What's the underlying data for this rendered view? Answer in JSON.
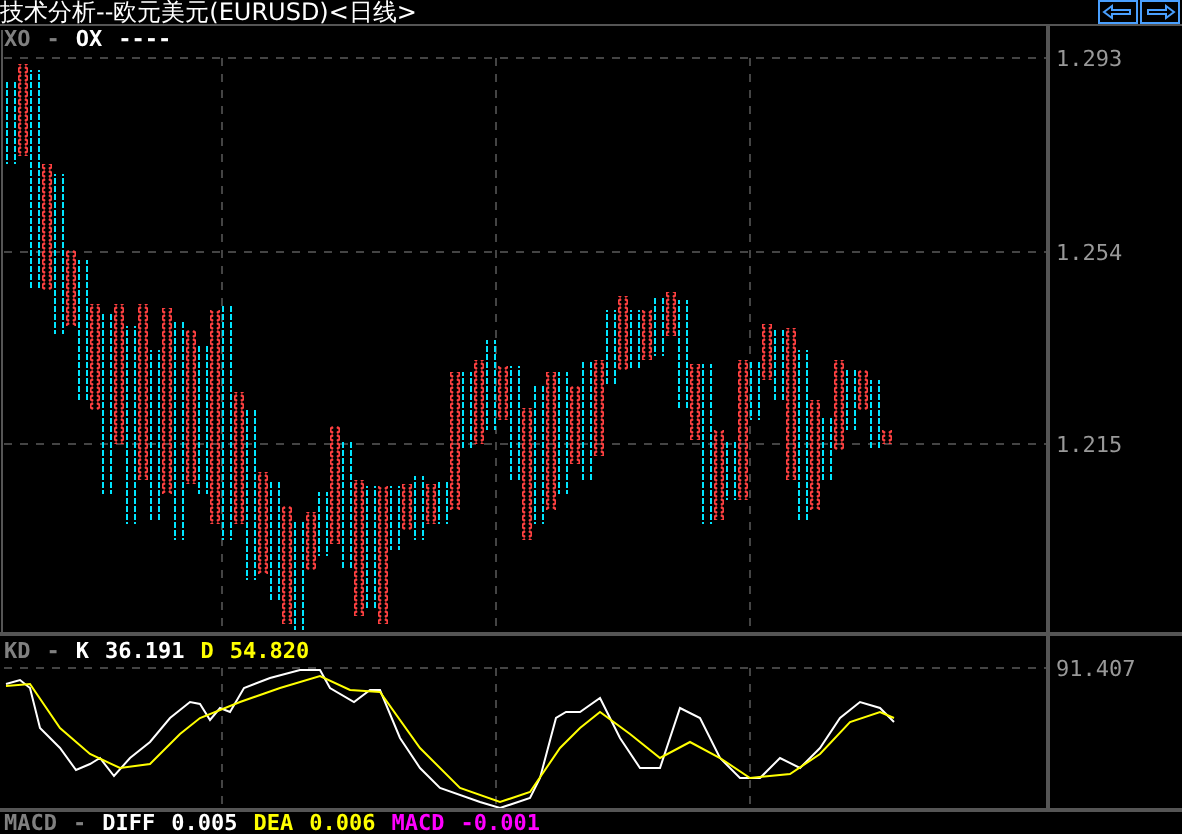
{
  "window": {
    "title": "技术分析--欧元美元(EURUSD)<日线>"
  },
  "main_chart": {
    "legend": [
      {
        "text": "XO",
        "color": "#808080"
      },
      {
        "text": "-",
        "color": "#808080"
      },
      {
        "text": "OX",
        "color": "#ffffff"
      },
      {
        "text": "----",
        "color": "#ffffff"
      }
    ],
    "axis_labels": [
      "1.293",
      "1.254",
      "1.215"
    ]
  },
  "kd_panel": {
    "legend": [
      {
        "text": "KD",
        "color": "#808080"
      },
      {
        "text": "-",
        "color": "#808080"
      },
      {
        "text": "K",
        "color": "#ffffff"
      },
      {
        "text": "36.191",
        "color": "#ffffff"
      },
      {
        "text": "D",
        "color": "#ffff00"
      },
      {
        "text": "54.820",
        "color": "#ffff00"
      }
    ],
    "axis_labels": [
      "91.407"
    ]
  },
  "macd_panel": {
    "legend": [
      {
        "text": "MACD",
        "color": "#808080"
      },
      {
        "text": "-",
        "color": "#808080"
      },
      {
        "text": "DIFF",
        "color": "#ffffff"
      },
      {
        "text": "0.005",
        "color": "#ffffff"
      },
      {
        "text": "DEA",
        "color": "#ffff00"
      },
      {
        "text": "0.006",
        "color": "#ffff00"
      },
      {
        "text": "MACD",
        "color": "#ff00ff"
      },
      {
        "text": "-0.001",
        "color": "#ff00ff"
      }
    ]
  }
}
